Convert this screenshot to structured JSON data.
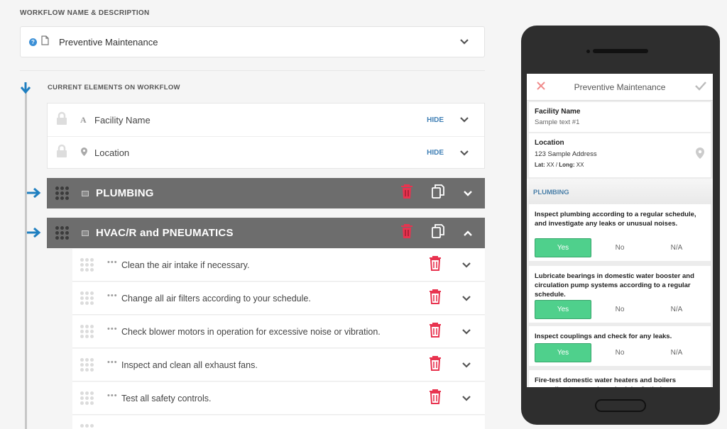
{
  "header": {
    "section_label": "WORKFLOW NAME & DESCRIPTION",
    "workflow_name": "Preventive Maintenance"
  },
  "elements": {
    "section_label": "CURRENT ELEMENTS ON WORKFLOW",
    "fields": [
      {
        "label": "Facility Name",
        "type_glyph": "A",
        "action": "HIDE"
      },
      {
        "label": "Location",
        "action": "HIDE"
      }
    ],
    "groups": [
      {
        "title": "PLUMBING",
        "expanded": false
      },
      {
        "title": "HVAC/R and PNEUMATICS",
        "expanded": true
      }
    ],
    "tasks": [
      {
        "label": "Clean the air intake if necessary."
      },
      {
        "label": "Change all air filters according to your schedule."
      },
      {
        "label": "Check blower motors in operation for excessive noise or vibration."
      },
      {
        "label": "Inspect and clean all exhaust fans."
      },
      {
        "label": "Test all safety controls."
      }
    ],
    "dots_glyph": "•••"
  },
  "preview": {
    "title": "Preventive Maintenance",
    "facility_label": "Facility Name",
    "facility_value": "Sample text #1",
    "location_label": "Location",
    "location_value": "123 Sample Address",
    "latlong_lat": "Lat:",
    "latlong_lat_val": "XX",
    "latlong_sep": "/",
    "latlong_long": "Long:",
    "latlong_long_val": "XX",
    "section": "PLUMBING",
    "questions": [
      {
        "text": "Inspect plumbing according to a regular schedule, and investigate any leaks or unusual noises.",
        "selected": "Yes"
      },
      {
        "text": "Lubricate bearings in domestic water booster and circulation pump systems according to a regular schedule.",
        "selected": "Yes"
      },
      {
        "text": "Inspect couplings and check for any leaks.",
        "selected": "Yes"
      },
      {
        "text": "Fire-test domestic water heaters and boilers according to a regular schedule. Optimize"
      }
    ],
    "answers": {
      "yes": "Yes",
      "no": "No",
      "na": "N/A"
    }
  },
  "colors": {
    "accent_blue": "#3f7fb5",
    "arrow_blue": "#1f7fc0",
    "delete_red": "#e8334f",
    "yes_green": "#4fd08c",
    "group_gray": "#6d6d6d"
  },
  "icons": {
    "help": "question-circle-icon",
    "document": "document-icon",
    "lock": "lock-icon",
    "pin": "map-pin-icon",
    "trash": "trash-icon",
    "copy": "copy-icon",
    "chevron": "chevron-icon",
    "grip": "drag-grip-icon"
  }
}
